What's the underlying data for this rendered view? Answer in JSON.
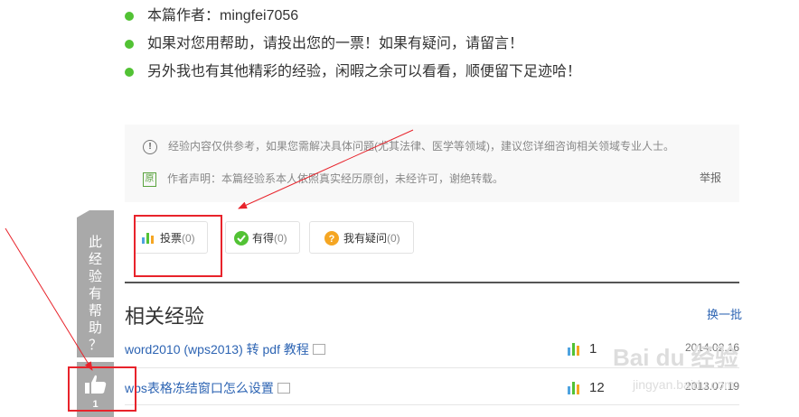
{
  "bullets": [
    "本篇作者：mingfei7056",
    "如果对您用帮助，请投出您的一票！如果有疑问，请留言！",
    "另外我也有其他精彩的经验，闲暇之余可以看看，顺便留下足迹哈！"
  ],
  "notice": {
    "disclaimer": "经验内容仅供参考，如果您需解决具体问题(尤其法律、医学等领域)，建议您详细咨询相关领域专业人士。",
    "author_statement": "作者声明：本篇经验系本人依照真实经历原创，未经许可，谢绝转载。",
    "original_badge": "原",
    "report": "举报"
  },
  "actions": {
    "vote": {
      "label": "投票",
      "count": "(0)"
    },
    "helpful": {
      "label": "有得",
      "count": "(0)"
    },
    "question": {
      "label": "我有疑问",
      "count": "(0)"
    }
  },
  "related": {
    "title": "相关经验",
    "refresh": "换一批",
    "items": [
      {
        "title": "word2010 (wps2013) 转 pdf 教程",
        "count": "1",
        "date": "2014.02.16"
      },
      {
        "title": "wps表格冻结窗口怎么设置",
        "count": "12",
        "date": "2013.07.19"
      }
    ]
  },
  "sidebar": {
    "chars": [
      "此",
      "经",
      "验",
      "有",
      "帮",
      "助",
      "？"
    ],
    "like_count": "1"
  },
  "watermark": {
    "text": "Bai du 经验",
    "url": "jingyan.baidu.com"
  },
  "colors": {
    "bullet": "#52c234",
    "link": "#2d64b3",
    "annotation": "#e8232b",
    "sidebar": "#a9a9a9"
  }
}
